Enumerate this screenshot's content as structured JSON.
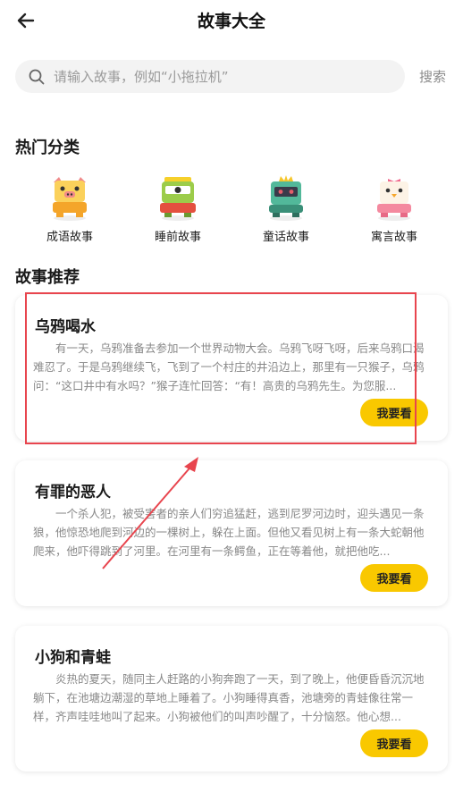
{
  "header": {
    "title": "故事大全",
    "back_icon": "arrow-left-icon"
  },
  "search": {
    "placeholder": "请输入故事，例如“小拖拉机”",
    "button_label": "搜索",
    "icon": "search-icon"
  },
  "hot_categories": {
    "title": "热门分类",
    "items": [
      {
        "label": "成语故事",
        "icon": "pig-mascot-icon",
        "color": "#f7b733"
      },
      {
        "label": "睡前故事",
        "icon": "frog-mascot-icon",
        "color": "#8dc63f"
      },
      {
        "label": "童话故事",
        "icon": "robot-mascot-icon",
        "color": "#3fa58c"
      },
      {
        "label": "寓言故事",
        "icon": "chick-mascot-icon",
        "color": "#f28aa0"
      }
    ]
  },
  "recommend": {
    "title": "故事推荐",
    "stories": [
      {
        "title": "乌鸦喝水",
        "summary": "有一天，乌鸦准备去参加一个世界动物大会。乌鸦飞呀飞呀，后来乌鸦口渴难忍了。于是乌鸦继续飞，飞到了一个村庄的井沿边上，那里有一只猴子，乌鸦问：“这口井中有水吗？”猴子连忙回答：“有！高贵的乌鸦先生。为您服...",
        "button_label": "我要看"
      },
      {
        "title": "有罪的恶人",
        "summary": "一个杀人犯，被受害者的亲人们穷追猛赶，逃到尼罗河边时，迎头遇见一条狼，他惊恐地爬到河边的一棵树上，躲在上面。但他又看见树上有一条大蛇朝他爬来，他吓得跳到了河里。在河里有一条鳄鱼，正在等着他，就把他吃...",
        "button_label": "我要看"
      },
      {
        "title": "小狗和青蛙",
        "summary": "炎热的夏天，随同主人赶路的小狗奔跑了一天，到了晚上，他便昏昏沉沉地躺下，在池塘边潮湿的草地上睡着了。小狗睡得真香，池塘旁的青蛙像往常一样，齐声哇哇地叫了起来。小狗被他们的叫声吵醒了，十分恼怒。他心想...",
        "button_label": "我要看"
      }
    ]
  },
  "colors": {
    "accent": "#f9c800",
    "annotation": "#e8454e"
  }
}
